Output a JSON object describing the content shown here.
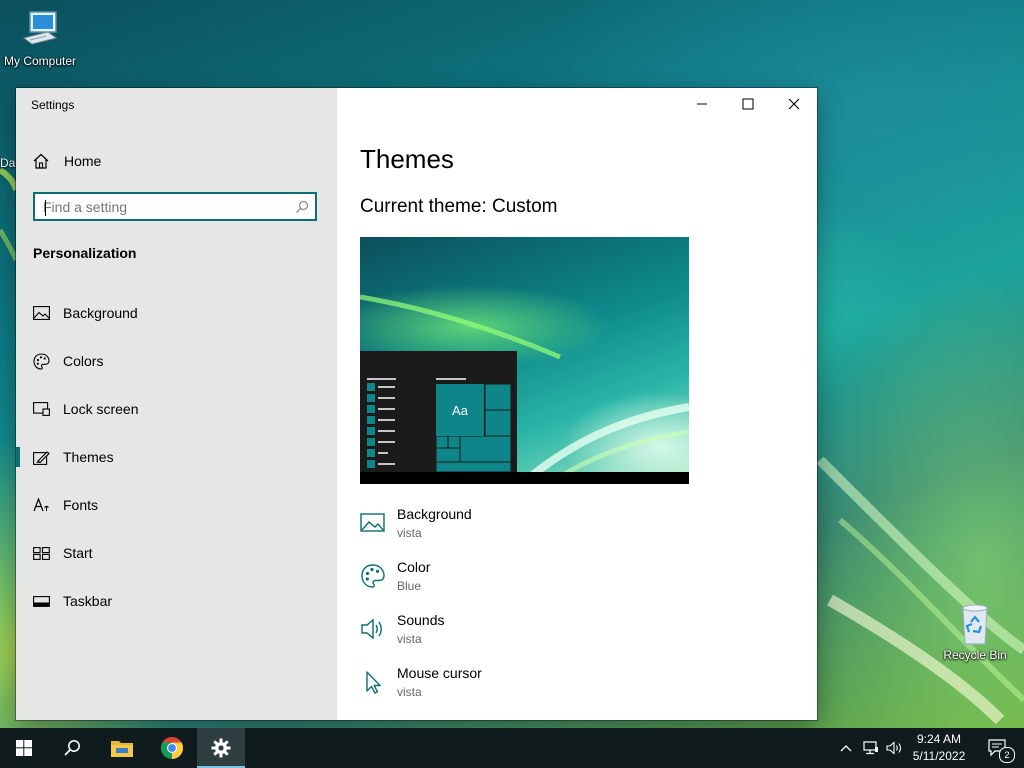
{
  "desktop": {
    "icons": [
      {
        "label": "My Computer"
      },
      {
        "label": "Recycle Bin"
      }
    ],
    "partial_label": "Da"
  },
  "window": {
    "title": "Settings",
    "controls": {
      "minimize": "minimize",
      "maximize": "maximize",
      "close": "close"
    }
  },
  "sidebar": {
    "home_label": "Home",
    "search": {
      "placeholder": "Find a setting",
      "value": ""
    },
    "section_title": "Personalization",
    "items": [
      {
        "label": "Background",
        "icon": "picture-icon"
      },
      {
        "label": "Colors",
        "icon": "palette-icon"
      },
      {
        "label": "Lock screen",
        "icon": "lock-screen-icon"
      },
      {
        "label": "Themes",
        "icon": "brush-icon",
        "selected": true
      },
      {
        "label": "Fonts",
        "icon": "font-icon"
      },
      {
        "label": "Start",
        "icon": "start-icon"
      },
      {
        "label": "Taskbar",
        "icon": "taskbar-icon"
      }
    ]
  },
  "main": {
    "title": "Themes",
    "current_theme": "Current theme: Custom",
    "preview_tile_text": "Aa",
    "options": [
      {
        "label": "Background",
        "value": "vista",
        "icon": "picture-icon"
      },
      {
        "label": "Color",
        "value": "Blue",
        "icon": "palette-icon"
      },
      {
        "label": "Sounds",
        "value": "vista",
        "icon": "speaker-icon"
      },
      {
        "label": "Mouse cursor",
        "value": "vista",
        "icon": "cursor-icon"
      }
    ]
  },
  "taskbar": {
    "time": "9:24 AM",
    "date": "5/11/2022",
    "notification_count": "2"
  },
  "colors": {
    "accent": "#0b6f73",
    "sidebar_bg": "#e6e6e6",
    "taskbar_bg": "#0f1b1d"
  }
}
